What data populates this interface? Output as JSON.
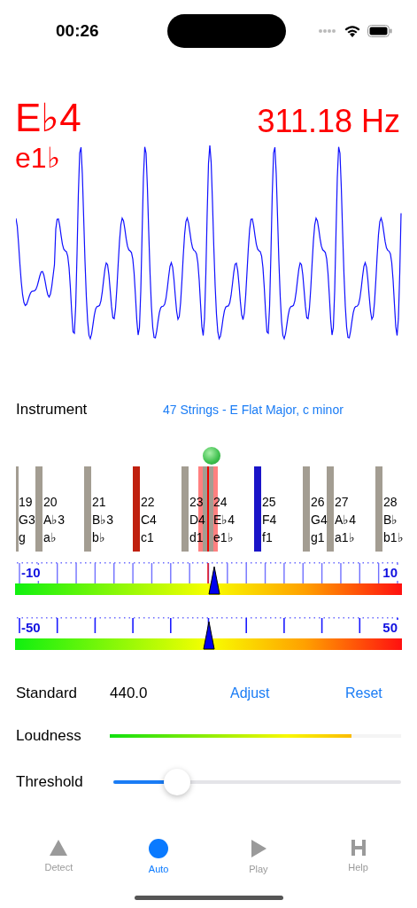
{
  "status_bar": {
    "time": "00:26"
  },
  "detected": {
    "note": "E♭4",
    "frequency": "311.18 Hz",
    "solfa": "e1♭"
  },
  "instrument": {
    "label": "Instrument",
    "value": "47 Strings - E Flat Major, c minor"
  },
  "strings": [
    {
      "number": "19",
      "note": "G3",
      "solfa": "g",
      "color": "#a39d92",
      "selected": false
    },
    {
      "number": "20",
      "note": "A♭3",
      "solfa": "a♭",
      "color": "#a39d92",
      "selected": false
    },
    {
      "number": "21",
      "note": "B♭3",
      "solfa": "b♭",
      "color": "#a39d92",
      "selected": false
    },
    {
      "number": "22",
      "note": "C4",
      "solfa": "c1",
      "color": "#c0200f",
      "selected": false
    },
    {
      "number": "23",
      "note": "D4",
      "solfa": "d1",
      "color": "#a39d92",
      "selected": false
    },
    {
      "number": "24",
      "note": "E♭4",
      "solfa": "e1♭",
      "color": "#a39d92",
      "selected": true
    },
    {
      "number": "25",
      "note": "F4",
      "solfa": "f1",
      "color": "#1a14c8",
      "selected": false
    },
    {
      "number": "26",
      "note": "G4",
      "solfa": "g1",
      "color": "#a39d92",
      "selected": false
    },
    {
      "number": "27",
      "note": "A♭4",
      "solfa": "a1♭",
      "color": "#a39d92",
      "selected": false
    },
    {
      "number": "28",
      "note": "B♭",
      "solfa": "b1♭",
      "color": "#a39d92",
      "selected": false
    }
  ],
  "meters": [
    {
      "min_label": "-10",
      "max_label": "10",
      "level": 0.514
    },
    {
      "min_label": "-50",
      "max_label": "50",
      "level": 0.502
    }
  ],
  "standard": {
    "label": "Standard",
    "value": "440.0",
    "adjust": "Adjust",
    "reset": "Reset"
  },
  "loudness": {
    "label": "Loudness",
    "level": 0.83
  },
  "threshold": {
    "label": "Threshold",
    "level": 0.22
  },
  "tabs": [
    {
      "label": "Detect",
      "selected": false
    },
    {
      "label": "Auto",
      "selected": true
    },
    {
      "label": "Play",
      "selected": false
    },
    {
      "label": "Help",
      "selected": false
    }
  ]
}
